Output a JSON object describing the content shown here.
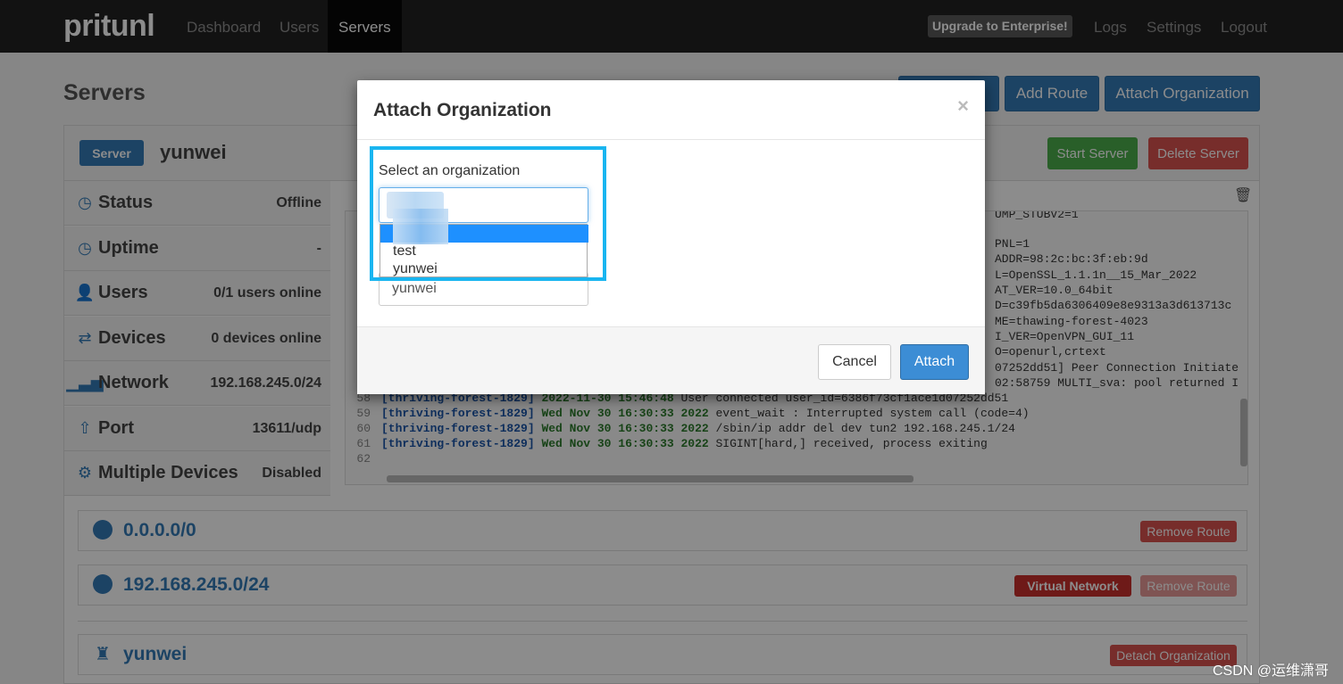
{
  "nav": {
    "brand": "pritunl",
    "links": [
      "Dashboard",
      "Users",
      "Servers"
    ],
    "upgrade": "Upgrade to Enterprise!",
    "right_links": [
      "Logs",
      "Settings",
      "Logout"
    ]
  },
  "page": {
    "title": "Servers",
    "top_buttons": [
      "Add Route",
      "Attach Organization"
    ]
  },
  "server": {
    "label": "Server",
    "name": "yunwei",
    "start": "Start Server",
    "delete": "Delete Server",
    "stats": [
      {
        "label": "Status",
        "value": "Offline",
        "icon": "clock-icon"
      },
      {
        "label": "Uptime",
        "value": "-",
        "icon": "clock-icon"
      },
      {
        "label": "Users",
        "value": "0/1 users online",
        "icon": "user-icon"
      },
      {
        "label": "Devices",
        "value": "0 devices online",
        "icon": "transfer-icon"
      },
      {
        "label": "Network",
        "value": "192.168.245.0/24",
        "icon": "signal-icon"
      },
      {
        "label": "Port",
        "value": "13611/udp",
        "icon": "upload-icon"
      },
      {
        "label": "Multiple Devices",
        "value": "Disabled",
        "icon": "gear-icon"
      }
    ]
  },
  "log": {
    "right_fragments": [
      "UMP_STUBV2=1",
      "PNL=1",
      "ADDR=98:2c:bc:3f:eb:9d",
      "L=OpenSSL_1.1.1n__15_Mar_2022",
      "AT_VER=10.0_64bit",
      "D=c39fb5da6306409e8e9313a3d613713c",
      "ME=thawing-forest-4023",
      "I_VER=OpenVPN_GUI_11",
      "O=openurl,crtext",
      "07252dd51] Peer Connection Initiate",
      "02:58759 MULTI_sva: pool returned I"
    ],
    "lines": [
      {
        "n": "58",
        "tag": "[thriving-forest-1829]",
        "date": "2022-11-30 15:46:48",
        "text": "User connected user_id=6386f73cf1ace1d07252dd51"
      },
      {
        "n": "59",
        "tag": "[thriving-forest-1829]",
        "date": "Wed Nov 30 16:30:33 2022",
        "text": "event_wait : Interrupted system call (code=4)"
      },
      {
        "n": "60",
        "tag": "[thriving-forest-1829]",
        "date": "Wed Nov 30 16:30:33 2022",
        "text": "/sbin/ip addr del dev tun2 192.168.245.1/24"
      },
      {
        "n": "61",
        "tag": "[thriving-forest-1829]",
        "date": "Wed Nov 30 16:30:33 2022",
        "text": "SIGINT[hard,] received, process exiting"
      },
      {
        "n": "62",
        "tag": "",
        "date": "",
        "text": ""
      }
    ]
  },
  "routes": [
    {
      "text": "0.0.0.0/0",
      "remove": "Remove Route"
    },
    {
      "text": "192.168.245.0/24",
      "virtual": "Virtual Network",
      "remove": "Remove Route"
    }
  ],
  "org": {
    "name": "yunwei",
    "detach": "Detach Organization"
  },
  "modal": {
    "title": "Attach Organization",
    "close": "×",
    "field_label": "Select an organization",
    "options": [
      "test",
      "yunwei"
    ],
    "under_value": "yunwei",
    "cancel": "Cancel",
    "attach": "Attach"
  },
  "watermark": "CSDN @运维潇哥",
  "colors": {
    "primary": "#337ab7",
    "highlight": "#19b5f0",
    "danger": "#d9534f",
    "success": "#4cae4c"
  }
}
